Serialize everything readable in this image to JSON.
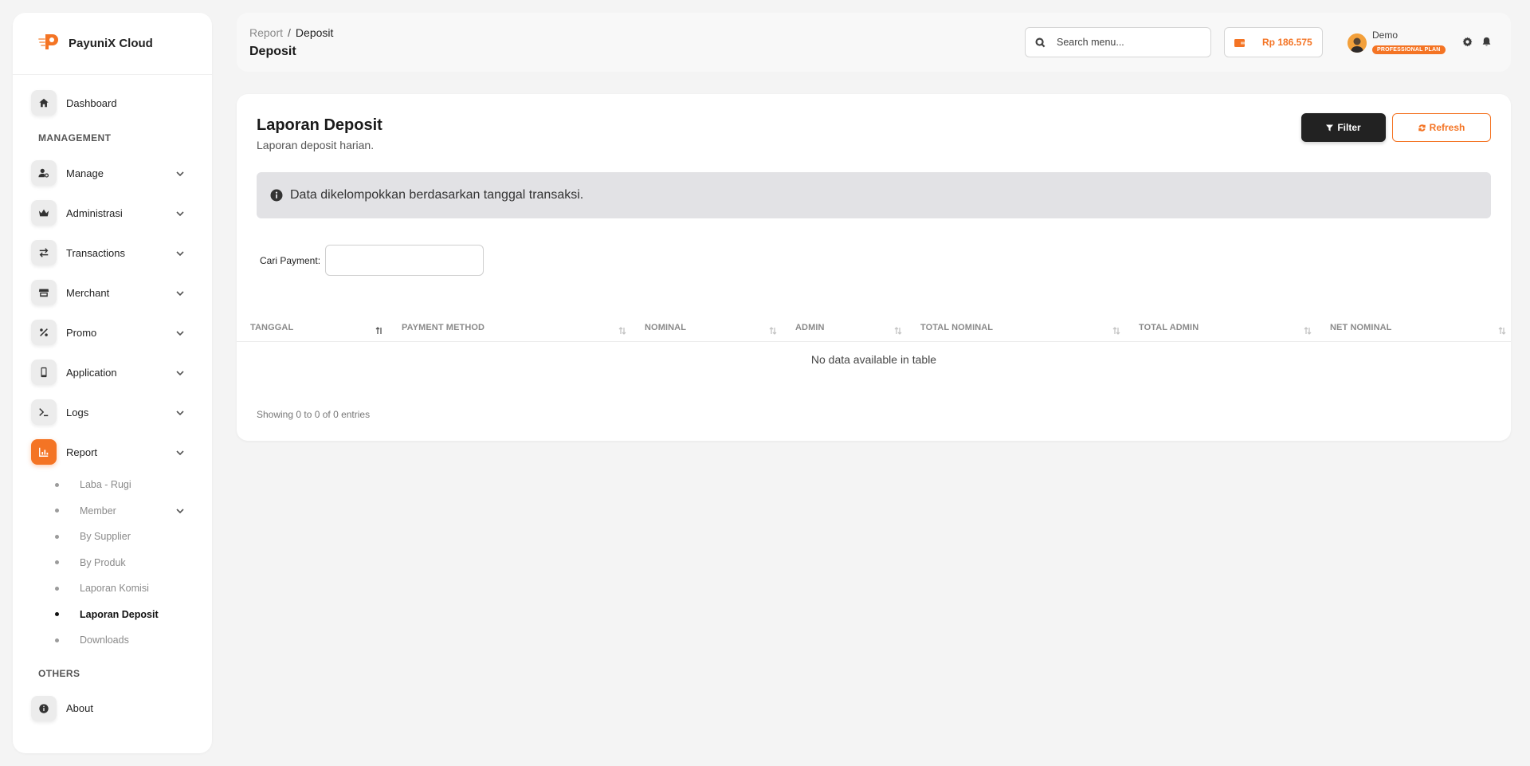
{
  "app": {
    "brand_name": "PayuniX Cloud",
    "accent_color": "#f47424"
  },
  "sidebar": {
    "dashboard_label": "Dashboard",
    "section_management": "MANAGEMENT",
    "items": [
      {
        "label": "Manage",
        "icon": "user-gear-icon"
      },
      {
        "label": "Administrasi",
        "icon": "crown-icon"
      },
      {
        "label": "Transactions",
        "icon": "swap-icon"
      },
      {
        "label": "Merchant",
        "icon": "store-icon"
      },
      {
        "label": "Promo",
        "icon": "percent-icon"
      },
      {
        "label": "Application",
        "icon": "mobile-icon"
      },
      {
        "label": "Logs",
        "icon": "terminal-icon"
      },
      {
        "label": "Report",
        "icon": "chart-icon"
      }
    ],
    "report_sub": [
      {
        "label": "Laba - Rugi"
      },
      {
        "label": "Member"
      },
      {
        "label": "By Supplier"
      },
      {
        "label": "By Produk"
      },
      {
        "label": "Laporan Komisi"
      },
      {
        "label": "Laporan Deposit"
      },
      {
        "label": "Downloads"
      }
    ],
    "section_others": "OTHERS",
    "about_label": "About"
  },
  "header": {
    "breadcrumb_parent": "Report",
    "breadcrumb_sep": "/",
    "breadcrumb_current": "Deposit",
    "page_title": "Deposit",
    "search_placeholder": "Search menu...",
    "balance": "Rp 186.575",
    "user_name": "Demo",
    "plan": "PROFESSIONAL PLAN"
  },
  "card": {
    "title": "Laporan Deposit",
    "subtitle": "Laporan deposit harian.",
    "filter_label": "Filter",
    "refresh_label": "Refresh",
    "alert_text": "Data dikelompokkan berdasarkan tanggal transaksi.",
    "search_label": "Cari Payment:",
    "search_value": "",
    "columns": [
      "TANGGAL",
      "PAYMENT METHOD",
      "NOMINAL",
      "ADMIN",
      "TOTAL NOMINAL",
      "TOTAL ADMIN",
      "NET NOMINAL"
    ],
    "empty_text": "No data available in table",
    "info_text": "Showing 0 to 0 of 0 entries"
  }
}
